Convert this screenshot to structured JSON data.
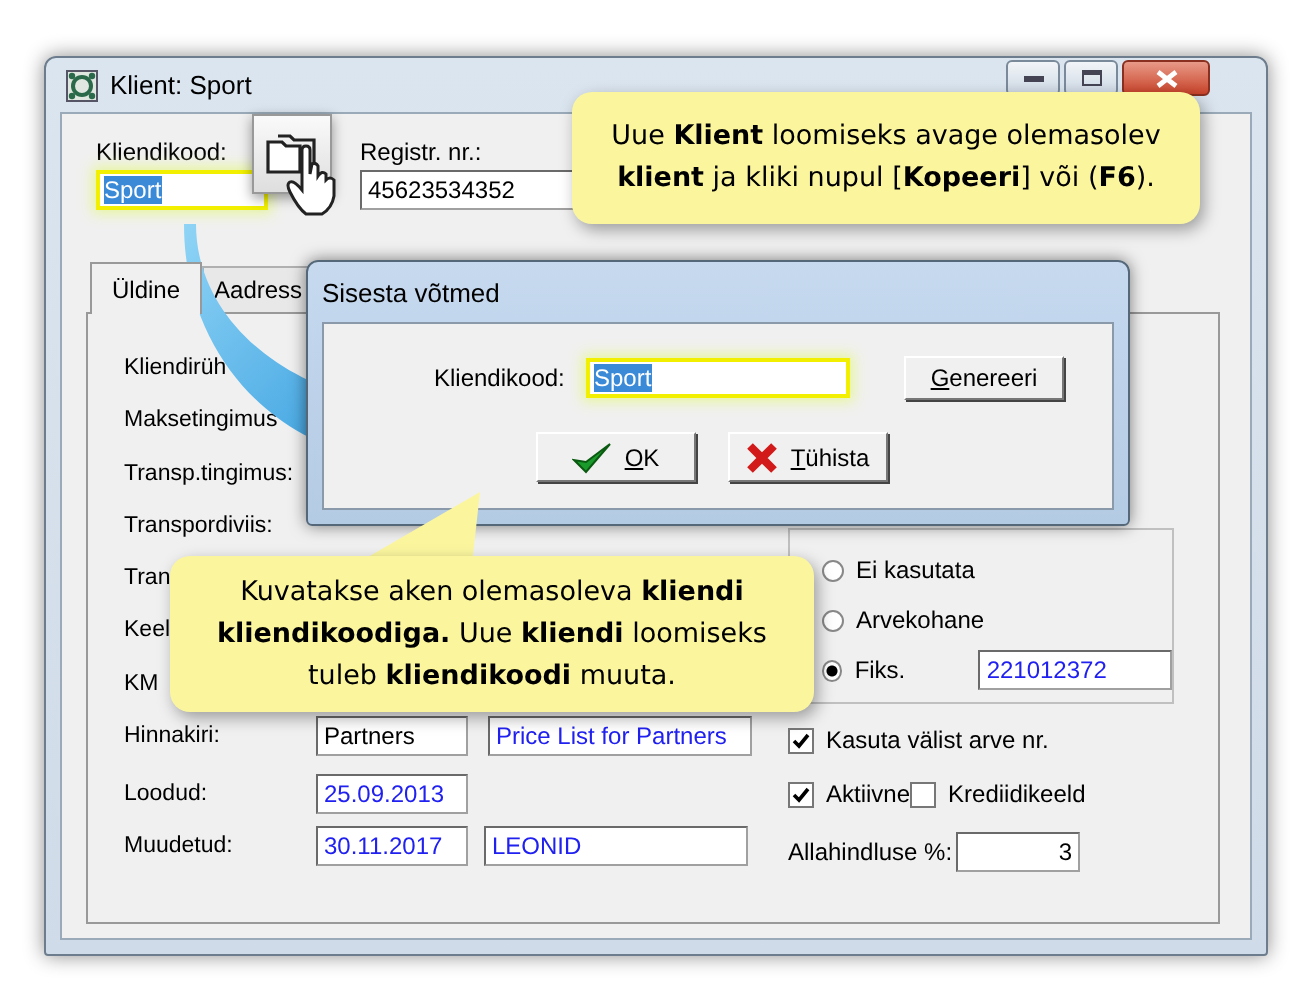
{
  "window": {
    "title": "Klient: Sport"
  },
  "header": {
    "client_code": {
      "label": "Kliendikood:",
      "value": "Sport",
      "highlighted": true
    },
    "registry": {
      "label": "Registr. nr.:",
      "value": "45623534352"
    }
  },
  "tabs": [
    {
      "label": "Üldine",
      "selected": true
    },
    {
      "label": "Aadress",
      "selected": false
    }
  ],
  "form_rows": [
    {
      "label": "Kliendirüh"
    },
    {
      "label": "Maksetingimus"
    },
    {
      "label": "Transp.tingimus:"
    },
    {
      "label": "Transpordiviis:"
    },
    {
      "label": "Tran"
    },
    {
      "label": "Keel"
    },
    {
      "label": "KM"
    },
    {
      "label": "Hinnakiri:",
      "fields": [
        {
          "value": "Partners",
          "readonly": false
        },
        {
          "value": "Price List for Partners",
          "readonly": true
        }
      ]
    },
    {
      "label": "Loodud:",
      "fields": [
        {
          "value": "25.09.2013",
          "readonly": true
        }
      ]
    },
    {
      "label": "Muudetud:",
      "fields": [
        {
          "value": "30.11.2017",
          "readonly": true
        },
        {
          "value": "LEONID",
          "readonly": true
        }
      ]
    }
  ],
  "invoice_number": {
    "options": [
      {
        "label": "Ei kasutata",
        "selected": false
      },
      {
        "label": "Arvekohane",
        "selected": false
      },
      {
        "label": "Fiks.",
        "selected": true
      }
    ],
    "fixed_value": "221012372"
  },
  "checkboxes": [
    {
      "label": "Kasuta välist arve nr.",
      "checked": true
    },
    {
      "label": "Aktiivne",
      "checked": true
    },
    {
      "label": "Krediidikeeld",
      "checked": false
    }
  ],
  "discount": {
    "label": "Allahindluse %:",
    "value": "3"
  },
  "dialog": {
    "title": "Sisesta võtmed",
    "field_label": "Kliendikood:",
    "value": "Sport",
    "highlighted": true,
    "buttons": [
      {
        "kind": "generate",
        "label": "Genereeri"
      },
      {
        "kind": "ok",
        "label": "OK"
      },
      {
        "kind": "cancel",
        "label": "Tühista"
      }
    ]
  },
  "callouts": [
    {
      "text": "Uue **Klient** loomiseks avage olemasolev\n**klient** ja kliki nupul [**Kopeeri**] või (**F6**)."
    },
    {
      "text": "Kuvatakse aken olemasoleva **kliendi**\n**kliendikoodiga.**  Uue **kliendi** loomiseks\ntuleb **kliendikoodi**  muuta."
    }
  ]
}
